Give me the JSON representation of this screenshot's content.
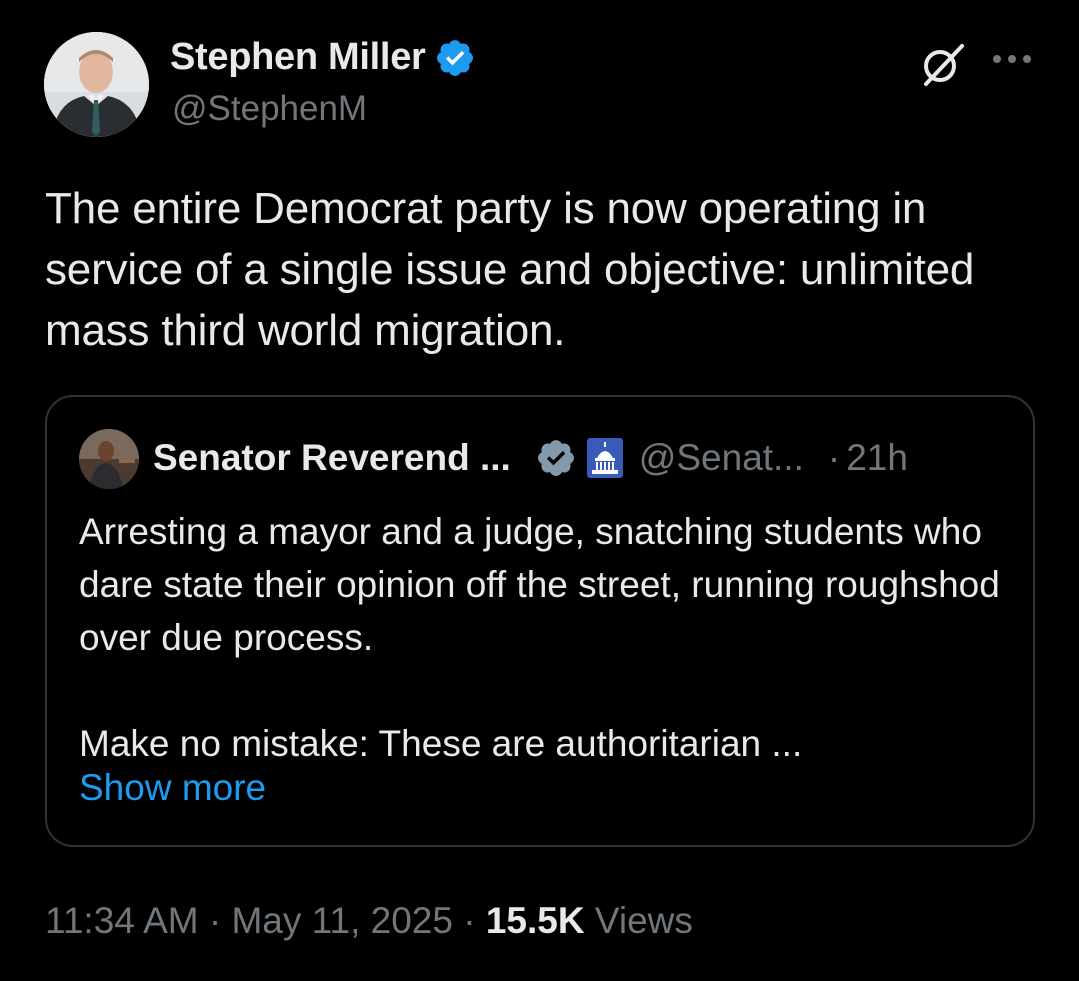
{
  "author": {
    "name": "Stephen Miller",
    "handle": "@StephenM"
  },
  "tweet": {
    "text": "The entire Democrat party is now operating in service of a single issue and objective: unlimited mass third world migration."
  },
  "quoted": {
    "name": "Senator Reverend ...",
    "handle": "@Senat...",
    "separator": "·",
    "time": "21h",
    "text": "Arresting a mayor and a judge, snatching students who dare state their opinion off the street, running roughshod over due process.\n\nMake no mistake: These are authoritarian ...",
    "show_more": "Show more"
  },
  "meta": {
    "time": "11:34 AM",
    "sep1": "·",
    "date": "May 11, 2025",
    "sep2": "·",
    "views_count": "15.5K",
    "views_label": "Views"
  },
  "icons": {
    "verified": "verified-badge-icon",
    "grok": "grok-icon",
    "more": "more-options-icon",
    "capitol": "capitol-building-icon"
  },
  "colors": {
    "background": "#000000",
    "text": "#e7e9ea",
    "muted": "#71767b",
    "accent": "#1d9bf0",
    "border": "#2f3336"
  }
}
